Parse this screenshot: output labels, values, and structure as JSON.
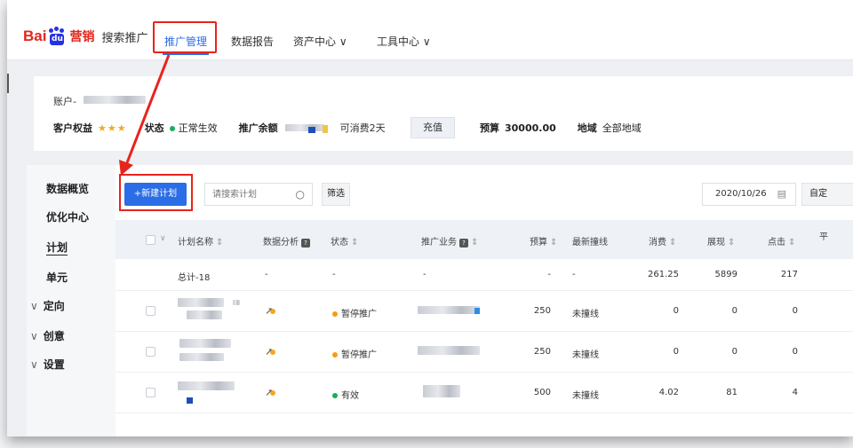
{
  "header": {
    "logo_bai": "Bai",
    "logo_du": "du",
    "logo_brand": "营销",
    "logo_product": "搜索推广",
    "nav": [
      {
        "label": "推广管理",
        "active": true
      },
      {
        "label": "数据报告"
      },
      {
        "label": "资产中心 ∨"
      },
      {
        "label": "工具中心 ∨"
      }
    ]
  },
  "account": {
    "account_label": "账户-",
    "rights_label": "客户权益",
    "rights_stars": "★★★",
    "status_label": "状态",
    "status_value": "正常生效",
    "balance_label": "推广余额",
    "balance_note": "可消费2天",
    "charge_button": "充值",
    "budget_label": "预算",
    "budget_value": "30000.00",
    "region_label": "地域",
    "region_value": "全部地域",
    "status_color": "#1aad5c"
  },
  "sidebar": {
    "items": [
      {
        "label": "数据概览"
      },
      {
        "label": "优化中心"
      },
      {
        "label": "计划",
        "active": true
      },
      {
        "label": "单元"
      },
      {
        "label": "定向"
      },
      {
        "label": "创意"
      },
      {
        "label": "设置"
      }
    ],
    "chevron": "∨"
  },
  "toolbar": {
    "new_plan_button": "+新建计划",
    "search_placeholder": "请搜索计划",
    "filter_button": "筛选",
    "date_value": "2020/10/26",
    "custom_button": "自定"
  },
  "table": {
    "headers": {
      "name": "计划名称",
      "analysis": "数据分析",
      "status": "状态",
      "business": "推广业务",
      "budget": "预算",
      "latest": "最新撞线",
      "cost": "消费",
      "impressions": "展现",
      "clicks": "点击",
      "avg": "平"
    },
    "sort_icon": "⇕",
    "total_row": {
      "name": "总计-18",
      "analysis": "-",
      "status": "-",
      "business": "-",
      "budget": "-",
      "latest": "-",
      "cost": "261.25",
      "impressions": "5899",
      "clicks": "217"
    },
    "rows": [
      {
        "status": "暂停推广",
        "status_color": "#f39c12",
        "budget": "250",
        "latest": "未撞线",
        "cost": "0",
        "impressions": "0",
        "clicks": "0"
      },
      {
        "status": "暂停推广",
        "status_color": "#f39c12",
        "budget": "250",
        "latest": "未撞线",
        "cost": "0",
        "impressions": "0",
        "clicks": "0"
      },
      {
        "status": "有效",
        "status_color": "#1aad5c",
        "budget": "500",
        "latest": "未撞线",
        "cost": "4.02",
        "impressions": "81",
        "clicks": "4"
      }
    ]
  },
  "colors": {
    "accent": "#2b6de6",
    "annotation_red": "#e8231d"
  }
}
